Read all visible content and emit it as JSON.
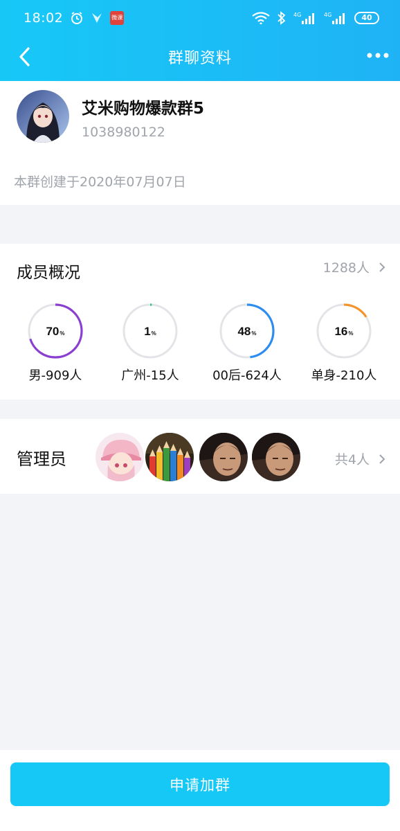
{
  "status_bar": {
    "time": "18:02",
    "app_badge": "微课",
    "signal1_label": "4G",
    "signal2_label": "4G",
    "battery": "40"
  },
  "nav": {
    "title": "群聊资料",
    "back_icon": "chevron-left-icon",
    "more_icon": "more-dots-icon"
  },
  "group": {
    "name": "艾米购物爆款群5",
    "id": "1038980122",
    "created": "本群创建于2020年07月07日"
  },
  "members": {
    "title": "成员概况",
    "count": "1288人",
    "stats": [
      {
        "percent": 70,
        "number": "70",
        "unit": "%",
        "label": "男-909人",
        "color": "#8b3fd1"
      },
      {
        "percent": 1,
        "number": "1",
        "unit": "%",
        "label": "广州-15人",
        "color": "#2fc48d"
      },
      {
        "percent": 48,
        "number": "48",
        "unit": "%",
        "label": "00后-624人",
        "color": "#2d8cf0"
      },
      {
        "percent": 16,
        "number": "16",
        "unit": "%",
        "label": "单身-210人",
        "color": "#f5932a"
      }
    ]
  },
  "admins": {
    "title": "管理员",
    "count": "共4人"
  },
  "footer": {
    "join_label": "申请加群"
  },
  "colors": {
    "header_start": "#17c8f7",
    "header_end": "#1fb3f5",
    "join_button": "#15c8f5"
  }
}
